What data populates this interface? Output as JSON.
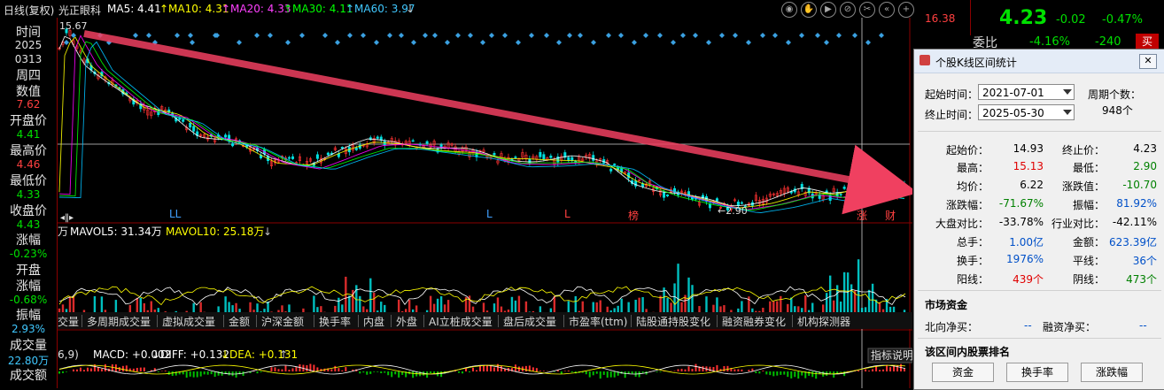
{
  "topbar": {
    "title": "日线(复权)",
    "stock": "光正眼科",
    "ma5": "MA5: 4.41",
    "ma10": "↑MA10: 4.31",
    "ma20": "↑MA20: 4.33",
    "ma30": "↑MA30: 4.11",
    "ma60": "↑MA60: 3.97",
    "down_arrow": "↓"
  },
  "price_top": "16.38",
  "quote": {
    "price": "4.23",
    "change": "-0.02",
    "pct": "-0.47%",
    "weibi_label": "委比",
    "weibi_pct": "-4.16%",
    "weibi_val": "-240",
    "sell": "买"
  },
  "left": {
    "time_label": "时间",
    "year": "2025",
    "date": "0313",
    "weekday": "周四",
    "value_label": "数值",
    "value": "7.62",
    "open_label": "开盘价",
    "open": "4.41",
    "high_label": "最高价",
    "high": "4.46",
    "low_label": "最低价",
    "low": "4.33",
    "close_label": "收盘价",
    "close": "4.43",
    "chg_label": "涨幅",
    "chg": "-0.23%",
    "openchg_label1": "开盘",
    "openchg_label2": "涨幅",
    "openchg": "-0.68%",
    "amp_label": "振幅",
    "amp": "2.93%",
    "vol_label": "成交量",
    "vol": "22.80万",
    "amt_label": "成交额"
  },
  "chart": {
    "max_label": "15.67",
    "min_label": "←2.90",
    "markers": [
      "LL",
      "L",
      "L",
      "榜",
      "涨",
      "财"
    ],
    "vol_indicator": {
      "unit": "万",
      "mavol5": "MAVOL5: 31.34万",
      "mavol10": "MAVOL10: 25.18万",
      "arrow": "↓"
    },
    "macd_indicator": {
      "params": "6,9)",
      "macd": "MACD: +0.002",
      "diff": "↓DIFF: +0.132",
      "dea": "↓DEA: +0.131",
      "arrow": "↑"
    },
    "indicator_help": "指标说明"
  },
  "tabs": [
    "交量",
    "多周期成交量",
    "虚拟成交量",
    "金额",
    "沪深金额",
    "换手率",
    "内盘",
    "外盘",
    "AI立桩成交量",
    "盘后成交量",
    "市盈率(ttm)",
    "陆股通持股变化",
    "融资融券变化",
    "机构探测器"
  ],
  "dialog": {
    "title": "个股K线区间统计",
    "start_label": "起始时间：",
    "start_value": "2021-07-01",
    "end_label": "终止时间：",
    "end_value": "2025-05-30",
    "period_label": "周期个数：",
    "period_value": "948个",
    "stats": [
      {
        "l1": "起始价：",
        "v1": "14.93",
        "l2": "终止价：",
        "v2": "4.23",
        "c1": "#000000",
        "c2": "#000000"
      },
      {
        "l1": "最高：",
        "v1": "15.13",
        "l2": "最低：",
        "v2": "2.90",
        "c1": "#e00000",
        "c2": "#008000"
      },
      {
        "l1": "均价：",
        "v1": "6.22",
        "l2": "涨跌值：",
        "v2": "-10.70",
        "c1": "#000000",
        "c2": "#008000"
      },
      {
        "l1": "涨跌幅：",
        "v1": "-71.67%",
        "l2": "振幅：",
        "v2": "81.92%",
        "c1": "#008000",
        "c2": "#0050c8"
      },
      {
        "l1": "大盘对比：",
        "v1": "-33.78%",
        "l2": "行业对比：",
        "v2": "-42.11%",
        "c1": "#000000",
        "c2": "#000000"
      },
      {
        "l1": "总手：",
        "v1": "1.00亿",
        "l2": "金额：",
        "v2": "623.39亿",
        "c1": "#0050c8",
        "c2": "#0050c8"
      },
      {
        "l1": "换手：",
        "v1": "1976%",
        "l2": "平线：",
        "v2": "36个",
        "c1": "#0050c8",
        "c2": "#0050c8"
      },
      {
        "l1": "阳线：",
        "v1": "439个",
        "l2": "阴线：",
        "v2": "473个",
        "c1": "#e00000",
        "c2": "#008000"
      }
    ],
    "fund_title": "市场资金",
    "north_label": "北向净买：",
    "north_value": "--",
    "margin_label": "融资净买：",
    "margin_value": "--",
    "rank_title": "该区间内股票排名",
    "btn_fund": "资金",
    "btn_turnover": "换手率",
    "btn_change": "涨跌幅"
  },
  "colors": {
    "up": "#ff3232",
    "down": "#00e0e0",
    "ma5": "#ffffff",
    "ma10": "#ffff00",
    "ma20": "#ff00ff",
    "ma30": "#00ff00",
    "ma60": "#00c0ff",
    "arrow": "#f04060"
  }
}
